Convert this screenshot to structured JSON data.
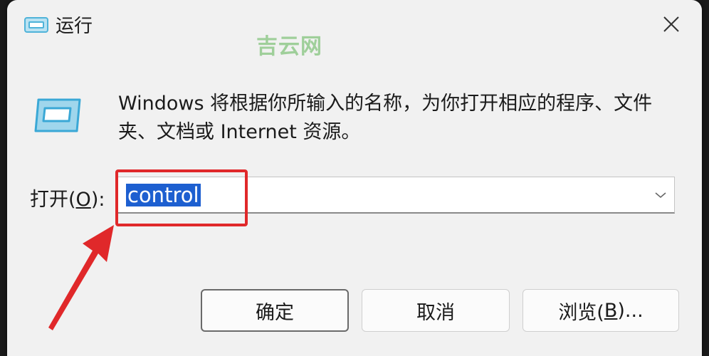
{
  "window": {
    "title": "运行",
    "watermark": "吉云网"
  },
  "description": "Windows 将根据你所输入的名称，为你打开相应的程序、文件夹、文档或 Internet 资源。",
  "open_field": {
    "label_prefix": "打开(",
    "label_accel": "O",
    "label_suffix": "):",
    "value": "control"
  },
  "buttons": {
    "ok": "确定",
    "cancel": "取消",
    "browse_prefix": "浏览(",
    "browse_accel": "B",
    "browse_suffix": ")..."
  },
  "colors": {
    "selection": "#1d5fd0",
    "annotation": "#e0282a",
    "icon": "#4fb3d9"
  }
}
